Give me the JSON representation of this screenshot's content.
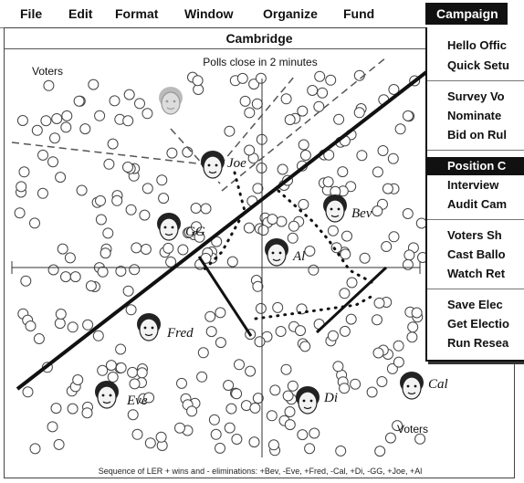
{
  "menubar": {
    "items": [
      "File",
      "Edit",
      "Format",
      "Window",
      "Organize",
      "Fund"
    ],
    "active_item": "Campaign"
  },
  "window": {
    "title": "Cambridge",
    "status": "Polls close in 2 minutes",
    "voters_label_top": "Voters",
    "voters_label_bottom": "Voters",
    "caption": "Sequence of LER + wins and - eliminations: +Bev, -Eve, +Fred, -Cal, +Di, -GG, +Joe, +Al"
  },
  "candidates": [
    "Joe",
    "Bev",
    "GG",
    "Al",
    "Fred",
    "Eve",
    "Di",
    "Cal"
  ],
  "campaign_menu": {
    "groups": [
      [
        "Hello Offic",
        "Quick Setu"
      ],
      [
        "Survey Vo",
        "Nominate",
        "Bid on Rul"
      ],
      [
        "Position C",
        "Interview",
        "Audit Cam"
      ],
      [
        "Voters Sh",
        "Cast Ballo",
        "Watch Ret"
      ],
      [
        "Save Elec",
        "Get Electio",
        "Run Resea"
      ]
    ],
    "selected": "Position C"
  }
}
